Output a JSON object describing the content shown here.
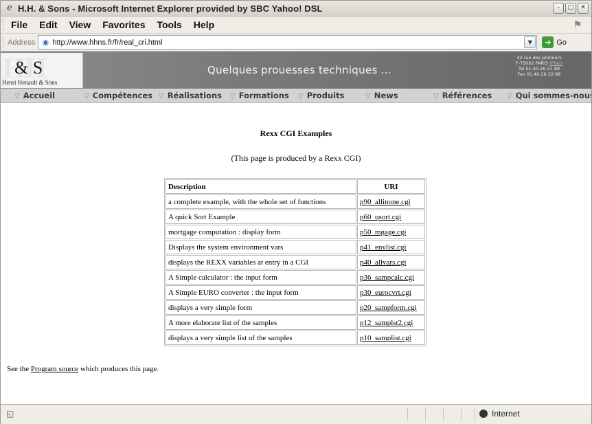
{
  "window": {
    "title": "H.H. & Sons - Microsoft Internet Explorer provided by SBC Yahoo! DSL",
    "controls": [
      "minimize",
      "maximize",
      "close"
    ]
  },
  "menu": {
    "items": [
      "File",
      "Edit",
      "View",
      "Favorites",
      "Tools",
      "Help"
    ]
  },
  "address": {
    "label": "Address",
    "url": "http://www.hhns.fr/fr/real_cri.html",
    "go_label": "Go"
  },
  "banner": {
    "logo_letters": "HH",
    "logo_mark": "& S",
    "logo_subtitle": "Henri Henault & Sons",
    "title": "Quelques prouesses techniques ...",
    "address_lines": [
      "42 rue des Jeûneurs",
      "F-75002 PARIS",
      "Tel 01.40.26.31.88",
      "Fax 01.40.26.32.88"
    ],
    "plan_link": "(Plan)"
  },
  "nav": {
    "items": [
      "Accueil",
      "Compétences",
      "Réalisations",
      "Formations",
      "Produits",
      "News",
      "Références",
      "Qui sommes-nous"
    ]
  },
  "page": {
    "heading": "Rexx CGI Examples",
    "subheading": "(This page is produced by a Rexx CGI)",
    "table": {
      "headers": [
        "Description",
        "URI"
      ],
      "rows": [
        {
          "description": "a complete example, with the whole set of functions",
          "uri": "p90_allinone.cgi"
        },
        {
          "description": "A quick Sort Example",
          "uri": "p60_qsort.cgi"
        },
        {
          "description": "mortgage computation : display form",
          "uri": "p50_mgage.cgi"
        },
        {
          "description": "Displays the system environment vars",
          "uri": "p41_envlist.cgi"
        },
        {
          "description": "displays the REXX variables at entry in a CGI",
          "uri": "p40_allvars.cgi"
        },
        {
          "description": "A Simple calculator : the input form",
          "uri": "p36_sampcalc.cgi"
        },
        {
          "description": "A Simple EURO converter : the input form",
          "uri": "p30_eurocvrt.cgi"
        },
        {
          "description": "displays a very simple form",
          "uri": "p20_sampform.cgi"
        },
        {
          "description": "A more elaborate list of the samples",
          "uri": "p12_samplst2.cgi"
        },
        {
          "description": "displays a very simple list of the samples",
          "uri": "p10_samplist.cgi"
        }
      ]
    },
    "footer": {
      "prefix": "See the ",
      "link": "Program source",
      "suffix": " which produces this page."
    }
  },
  "status": {
    "zone": "Internet"
  }
}
